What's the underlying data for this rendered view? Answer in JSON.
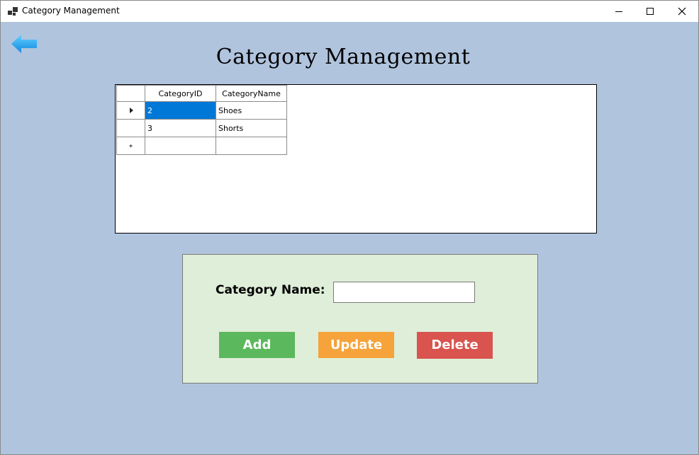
{
  "window": {
    "title": "Category Management"
  },
  "page": {
    "heading": "Category Management"
  },
  "grid": {
    "columns": [
      "CategoryID",
      "CategoryName"
    ],
    "rows": [
      {
        "id": "2",
        "name": "Shoes"
      },
      {
        "id": "3",
        "name": "Shorts"
      },
      {
        "id": "",
        "name": ""
      }
    ],
    "row_markers": [
      "▶",
      "",
      "*"
    ]
  },
  "form": {
    "category_name_label": "Category Name:",
    "category_name_value": ""
  },
  "buttons": {
    "add": "Add",
    "update": "Update",
    "delete": "Delete"
  },
  "colors": {
    "background": "#b0c4de",
    "panel": "#dfeed8",
    "add": "#5cb85c",
    "update": "#f5a33a",
    "delete": "#d9534f",
    "selection": "#0078d7"
  }
}
